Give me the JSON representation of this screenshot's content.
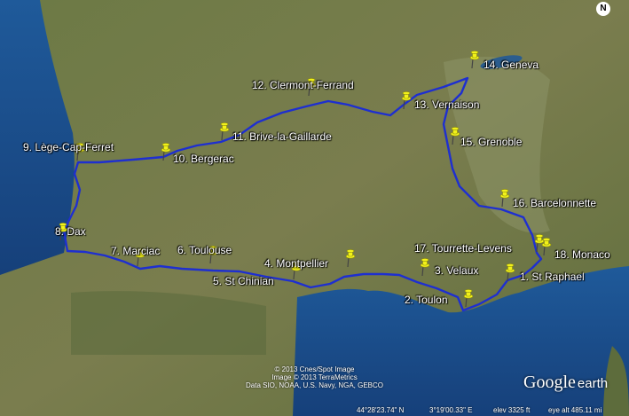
{
  "map": {
    "colors": {
      "route": "#1e2fd0",
      "pin": "#f2f21a",
      "sea": "#1c4f8a",
      "land": "#6f7d45"
    },
    "stops": [
      {
        "label": "1. St Raphael"
      },
      {
        "label": "2. Toulon"
      },
      {
        "label": "3. Velaux"
      },
      {
        "label": "4. Montpellier"
      },
      {
        "label": "5. St Chinian"
      },
      {
        "label": "6. Toulouse"
      },
      {
        "label": "7. Marciac"
      },
      {
        "label": "8. Dax"
      },
      {
        "label": "9. Lège-Cap-Ferret"
      },
      {
        "label": "10. Bergerac"
      },
      {
        "label": "11. Brive-la-Gaillarde"
      },
      {
        "label": "12. Clermont-Ferrand"
      },
      {
        "label": "13. Vernaison"
      },
      {
        "label": "14. Geneva"
      },
      {
        "label": "15. Grenoble"
      },
      {
        "label": "16. Barcelonnette"
      },
      {
        "label": "17. Tourrette-Levens"
      },
      {
        "label": "18. Monaco"
      }
    ],
    "credits": [
      "© 2013 Cnes/Spot Image",
      "Image © 2013 TerraMetrics",
      "Data SIO, NOAA, U.S. Navy, NGA, GEBCO"
    ],
    "status_bar": {
      "lat": "44°28'23.74\" N",
      "lon": "3°19'00.33\" E",
      "elev": "elev  3325 ft",
      "eye_alt": "eye alt 485.11 mi"
    },
    "logo": {
      "google": "Google",
      "earth": "earth"
    },
    "compass": {
      "label": "N"
    }
  }
}
